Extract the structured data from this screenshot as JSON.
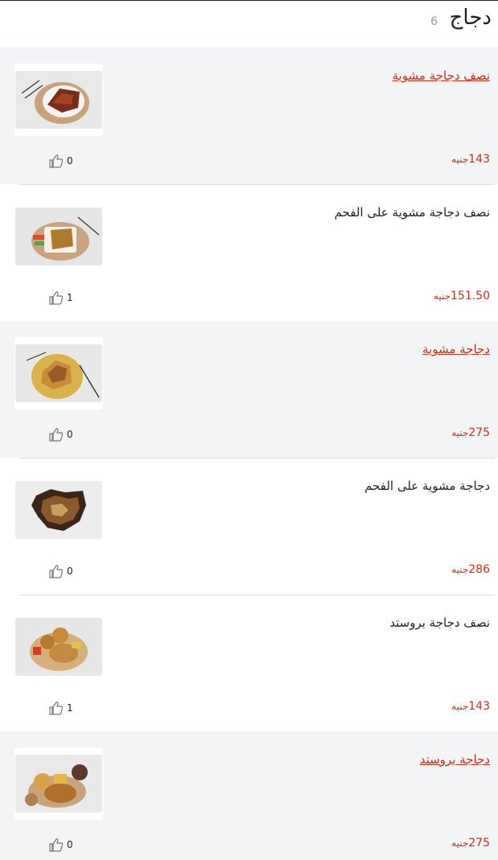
{
  "category": {
    "title": "دجاج",
    "count": "6"
  },
  "currency_label": "جنيه",
  "items": [
    {
      "name": "نصف دجاجة مشوية",
      "price": "143",
      "likes": "0",
      "link": true,
      "shaded": true,
      "photo": "half-grilled-chicken-photo"
    },
    {
      "name": "نصف دجاجة مشوية على الفحم",
      "price": "151.50",
      "likes": "1",
      "link": false,
      "shaded": false,
      "photo": "half-charcoal-chicken-photo"
    },
    {
      "name": "دجاجة مشوية",
      "price": "275",
      "likes": "0",
      "link": true,
      "shaded": true,
      "photo": "grilled-chicken-photo"
    },
    {
      "name": "دجاجة مشوية على الفحم",
      "price": "286",
      "likes": "0",
      "link": false,
      "shaded": false,
      "photo": "charcoal-chicken-photo"
    },
    {
      "name": "نصف دجاجة بروستد",
      "price": "143",
      "likes": "1",
      "link": false,
      "shaded": false,
      "photo": "half-broasted-chicken-photo"
    },
    {
      "name": "دجاجة بروستد",
      "price": "275",
      "likes": "0",
      "link": true,
      "shaded": true,
      "photo": "broasted-chicken-photo"
    }
  ],
  "colors": {
    "accent": "#c0311f",
    "shaded_row": "#f3f4f6",
    "text": "#222222"
  }
}
